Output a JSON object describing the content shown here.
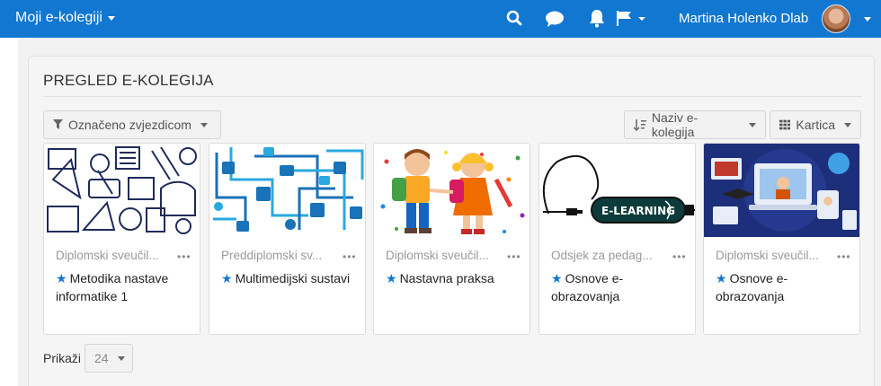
{
  "navbar": {
    "brand": "Moji e-kolegiji",
    "user_name": "Martina Holenko Dlab",
    "icons": [
      "search-icon",
      "chat-icon",
      "bell-icon",
      "flag-icon"
    ]
  },
  "panel": {
    "title": "PREGLED E-KOLEGIJA",
    "filter_label": "Označeno zvjezdicom",
    "sort_label": "Naziv e-kolegija",
    "view_label": "Kartica",
    "show_label": "Prikaži",
    "show_value": "24"
  },
  "courses": [
    {
      "category": "Diplomski sveučil...",
      "title": "Metodika nastave informatike 1",
      "more": "•••"
    },
    {
      "category": "Preddiplomski sv...",
      "title": "Multimedijski sustavi",
      "more": "•••"
    },
    {
      "category": "Diplomski sveučil...",
      "title": "Nastavna praksa",
      "more": "•••"
    },
    {
      "category": "Odsjek za pedag...",
      "title": "Osnove e-obrazovanja",
      "more": "•••"
    },
    {
      "category": "Diplomski sveučil...",
      "title": "Osnove e-obrazovanja",
      "more": "•••"
    }
  ],
  "elearning_text": "E-LEARNING",
  "colors": {
    "brand": "#1177d1",
    "star": "#1177d1"
  }
}
